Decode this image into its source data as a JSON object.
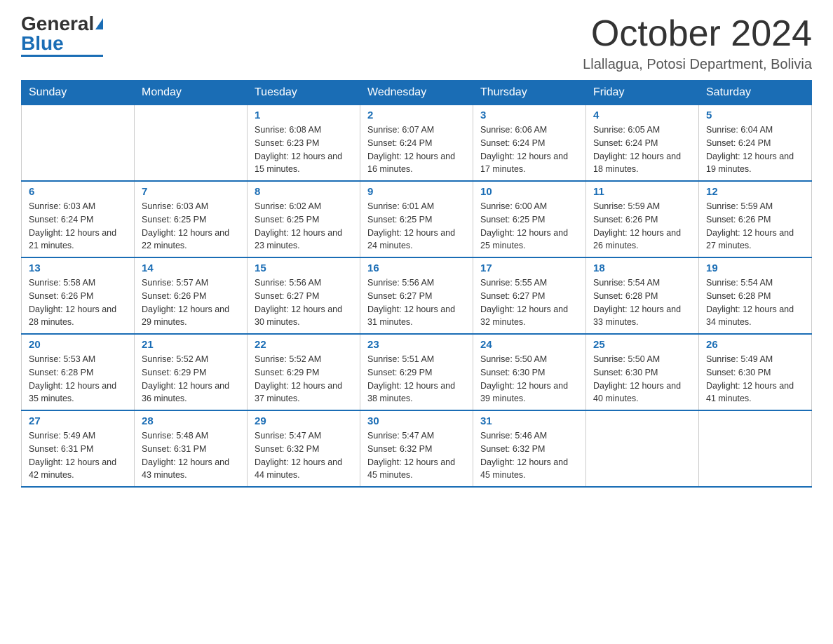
{
  "logo": {
    "text_general": "General",
    "text_blue": "Blue"
  },
  "header": {
    "month": "October 2024",
    "location": "Llallagua, Potosi Department, Bolivia"
  },
  "days_of_week": [
    "Sunday",
    "Monday",
    "Tuesday",
    "Wednesday",
    "Thursday",
    "Friday",
    "Saturday"
  ],
  "weeks": [
    [
      {
        "day": "",
        "sunrise": "",
        "sunset": "",
        "daylight": ""
      },
      {
        "day": "",
        "sunrise": "",
        "sunset": "",
        "daylight": ""
      },
      {
        "day": "1",
        "sunrise": "Sunrise: 6:08 AM",
        "sunset": "Sunset: 6:23 PM",
        "daylight": "Daylight: 12 hours and 15 minutes."
      },
      {
        "day": "2",
        "sunrise": "Sunrise: 6:07 AM",
        "sunset": "Sunset: 6:24 PM",
        "daylight": "Daylight: 12 hours and 16 minutes."
      },
      {
        "day": "3",
        "sunrise": "Sunrise: 6:06 AM",
        "sunset": "Sunset: 6:24 PM",
        "daylight": "Daylight: 12 hours and 17 minutes."
      },
      {
        "day": "4",
        "sunrise": "Sunrise: 6:05 AM",
        "sunset": "Sunset: 6:24 PM",
        "daylight": "Daylight: 12 hours and 18 minutes."
      },
      {
        "day": "5",
        "sunrise": "Sunrise: 6:04 AM",
        "sunset": "Sunset: 6:24 PM",
        "daylight": "Daylight: 12 hours and 19 minutes."
      }
    ],
    [
      {
        "day": "6",
        "sunrise": "Sunrise: 6:03 AM",
        "sunset": "Sunset: 6:24 PM",
        "daylight": "Daylight: 12 hours and 21 minutes."
      },
      {
        "day": "7",
        "sunrise": "Sunrise: 6:03 AM",
        "sunset": "Sunset: 6:25 PM",
        "daylight": "Daylight: 12 hours and 22 minutes."
      },
      {
        "day": "8",
        "sunrise": "Sunrise: 6:02 AM",
        "sunset": "Sunset: 6:25 PM",
        "daylight": "Daylight: 12 hours and 23 minutes."
      },
      {
        "day": "9",
        "sunrise": "Sunrise: 6:01 AM",
        "sunset": "Sunset: 6:25 PM",
        "daylight": "Daylight: 12 hours and 24 minutes."
      },
      {
        "day": "10",
        "sunrise": "Sunrise: 6:00 AM",
        "sunset": "Sunset: 6:25 PM",
        "daylight": "Daylight: 12 hours and 25 minutes."
      },
      {
        "day": "11",
        "sunrise": "Sunrise: 5:59 AM",
        "sunset": "Sunset: 6:26 PM",
        "daylight": "Daylight: 12 hours and 26 minutes."
      },
      {
        "day": "12",
        "sunrise": "Sunrise: 5:59 AM",
        "sunset": "Sunset: 6:26 PM",
        "daylight": "Daylight: 12 hours and 27 minutes."
      }
    ],
    [
      {
        "day": "13",
        "sunrise": "Sunrise: 5:58 AM",
        "sunset": "Sunset: 6:26 PM",
        "daylight": "Daylight: 12 hours and 28 minutes."
      },
      {
        "day": "14",
        "sunrise": "Sunrise: 5:57 AM",
        "sunset": "Sunset: 6:26 PM",
        "daylight": "Daylight: 12 hours and 29 minutes."
      },
      {
        "day": "15",
        "sunrise": "Sunrise: 5:56 AM",
        "sunset": "Sunset: 6:27 PM",
        "daylight": "Daylight: 12 hours and 30 minutes."
      },
      {
        "day": "16",
        "sunrise": "Sunrise: 5:56 AM",
        "sunset": "Sunset: 6:27 PM",
        "daylight": "Daylight: 12 hours and 31 minutes."
      },
      {
        "day": "17",
        "sunrise": "Sunrise: 5:55 AM",
        "sunset": "Sunset: 6:27 PM",
        "daylight": "Daylight: 12 hours and 32 minutes."
      },
      {
        "day": "18",
        "sunrise": "Sunrise: 5:54 AM",
        "sunset": "Sunset: 6:28 PM",
        "daylight": "Daylight: 12 hours and 33 minutes."
      },
      {
        "day": "19",
        "sunrise": "Sunrise: 5:54 AM",
        "sunset": "Sunset: 6:28 PM",
        "daylight": "Daylight: 12 hours and 34 minutes."
      }
    ],
    [
      {
        "day": "20",
        "sunrise": "Sunrise: 5:53 AM",
        "sunset": "Sunset: 6:28 PM",
        "daylight": "Daylight: 12 hours and 35 minutes."
      },
      {
        "day": "21",
        "sunrise": "Sunrise: 5:52 AM",
        "sunset": "Sunset: 6:29 PM",
        "daylight": "Daylight: 12 hours and 36 minutes."
      },
      {
        "day": "22",
        "sunrise": "Sunrise: 5:52 AM",
        "sunset": "Sunset: 6:29 PM",
        "daylight": "Daylight: 12 hours and 37 minutes."
      },
      {
        "day": "23",
        "sunrise": "Sunrise: 5:51 AM",
        "sunset": "Sunset: 6:29 PM",
        "daylight": "Daylight: 12 hours and 38 minutes."
      },
      {
        "day": "24",
        "sunrise": "Sunrise: 5:50 AM",
        "sunset": "Sunset: 6:30 PM",
        "daylight": "Daylight: 12 hours and 39 minutes."
      },
      {
        "day": "25",
        "sunrise": "Sunrise: 5:50 AM",
        "sunset": "Sunset: 6:30 PM",
        "daylight": "Daylight: 12 hours and 40 minutes."
      },
      {
        "day": "26",
        "sunrise": "Sunrise: 5:49 AM",
        "sunset": "Sunset: 6:30 PM",
        "daylight": "Daylight: 12 hours and 41 minutes."
      }
    ],
    [
      {
        "day": "27",
        "sunrise": "Sunrise: 5:49 AM",
        "sunset": "Sunset: 6:31 PM",
        "daylight": "Daylight: 12 hours and 42 minutes."
      },
      {
        "day": "28",
        "sunrise": "Sunrise: 5:48 AM",
        "sunset": "Sunset: 6:31 PM",
        "daylight": "Daylight: 12 hours and 43 minutes."
      },
      {
        "day": "29",
        "sunrise": "Sunrise: 5:47 AM",
        "sunset": "Sunset: 6:32 PM",
        "daylight": "Daylight: 12 hours and 44 minutes."
      },
      {
        "day": "30",
        "sunrise": "Sunrise: 5:47 AM",
        "sunset": "Sunset: 6:32 PM",
        "daylight": "Daylight: 12 hours and 45 minutes."
      },
      {
        "day": "31",
        "sunrise": "Sunrise: 5:46 AM",
        "sunset": "Sunset: 6:32 PM",
        "daylight": "Daylight: 12 hours and 45 minutes."
      },
      {
        "day": "",
        "sunrise": "",
        "sunset": "",
        "daylight": ""
      },
      {
        "day": "",
        "sunrise": "",
        "sunset": "",
        "daylight": ""
      }
    ]
  ]
}
